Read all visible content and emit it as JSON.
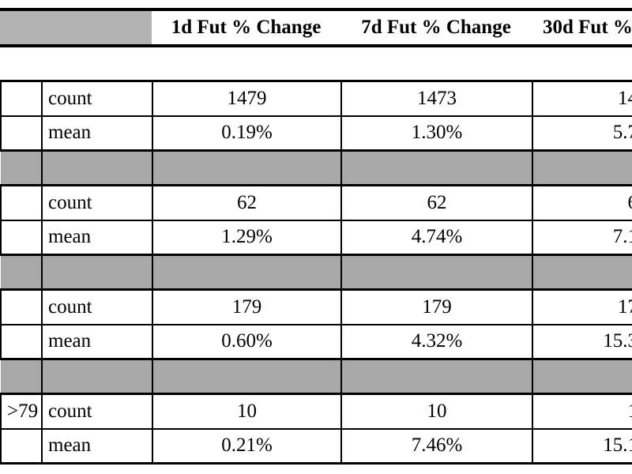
{
  "header": {
    "corner_label": "",
    "columns": [
      "1d Fut % Change",
      "7d Fut % Change",
      "30d Fut %"
    ]
  },
  "stat_labels": {
    "count": "count",
    "mean": "mean"
  },
  "rows": [
    {
      "type": "data",
      "group": "",
      "stat": "count",
      "values": [
        "1479",
        "1473",
        "14"
      ]
    },
    {
      "type": "data",
      "group": "",
      "stat": "mean",
      "values": [
        "0.19%",
        "1.30%",
        "5.7"
      ]
    },
    {
      "type": "spacer",
      "group": "",
      "stat": "",
      "values": [
        "",
        "",
        ""
      ]
    },
    {
      "type": "data",
      "group": "",
      "stat": "count",
      "values": [
        "62",
        "62",
        "6"
      ]
    },
    {
      "type": "data",
      "group": "",
      "stat": "mean",
      "values": [
        "1.29%",
        "4.74%",
        "7.1"
      ]
    },
    {
      "type": "spacer",
      "group": "",
      "stat": "",
      "values": [
        "",
        "",
        ""
      ]
    },
    {
      "type": "data",
      "group": "",
      "stat": "count",
      "values": [
        "179",
        "179",
        "17"
      ]
    },
    {
      "type": "data",
      "group": "",
      "stat": "mean",
      "values": [
        "0.60%",
        "4.32%",
        "15.3"
      ]
    },
    {
      "type": "spacer",
      "group": "",
      "stat": "",
      "values": [
        "",
        "",
        ""
      ]
    },
    {
      "type": "data",
      "group": ">79",
      "stat": "count",
      "values": [
        "10",
        "10",
        "1"
      ]
    },
    {
      "type": "data",
      "group": "",
      "stat": "mean",
      "values": [
        "0.21%",
        "7.46%",
        "15.1"
      ]
    }
  ],
  "colors": {
    "grid_line": "#000000",
    "spacer_fill": "#a8a8a8",
    "header_corner_fill": "#b3b3b3",
    "cell_fill": "#ffffff",
    "text": "#000000"
  }
}
